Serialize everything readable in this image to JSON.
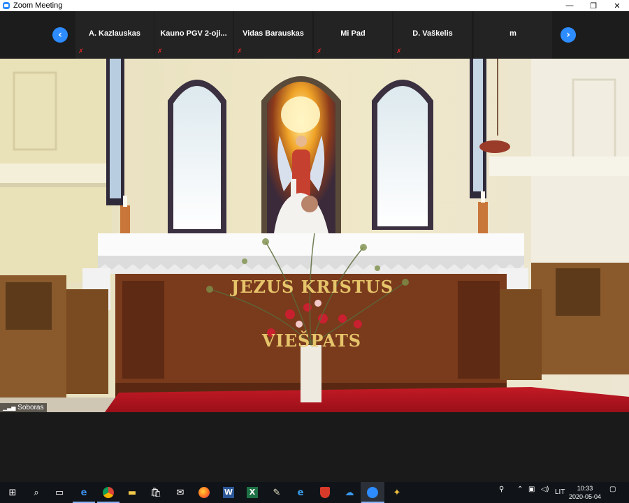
{
  "window": {
    "title": "Zoom Meeting",
    "minimize": "—",
    "maximize": "❐",
    "close": "✕"
  },
  "participants": [
    {
      "name": "A. Kazlauskas"
    },
    {
      "name": "Kauno  PGV  2-oji..."
    },
    {
      "name": "Vidas Barauskas"
    },
    {
      "name": "Mi Pad"
    },
    {
      "name": "D. Vaškelis"
    },
    {
      "name": "m"
    }
  ],
  "active_speaker": {
    "name": "Soboras"
  },
  "altar": {
    "line1": "JEZUS KRISTUS",
    "line2": "VIEŠPATS"
  },
  "taskbar": {
    "icons": [
      "start-icon",
      "search-icon",
      "task-view-icon",
      "edge-icon",
      "chrome-icon",
      "file-explorer-icon",
      "store-icon",
      "mail-icon",
      "firefox-icon",
      "word-icon",
      "excel-icon",
      "app-icon",
      "ie-icon",
      "antivirus-icon",
      "cloud-icon",
      "zoom-icon",
      "paint-icon"
    ],
    "language": "LIT",
    "time": "10:33",
    "date": "2020-05-04"
  },
  "colors": {
    "accent": "#2d8cff",
    "muted": "#e02828",
    "carpet": "#b3121d",
    "altar_wood": "#7a3a1c"
  }
}
